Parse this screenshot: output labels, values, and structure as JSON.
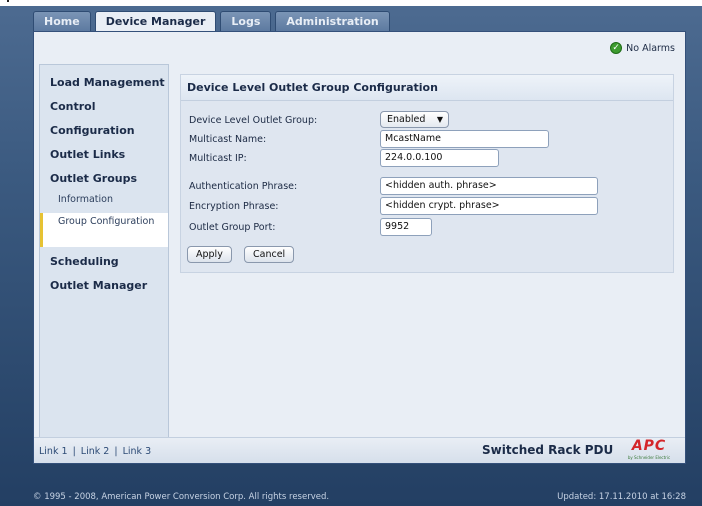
{
  "tabs": [
    {
      "label": "Home"
    },
    {
      "label": "Device Manager",
      "active": true
    },
    {
      "label": "Logs"
    },
    {
      "label": "Administration"
    }
  ],
  "alarm": {
    "text": "No Alarms",
    "icon": "check-circle-icon"
  },
  "nav": {
    "items": [
      {
        "label": "Load Management"
      },
      {
        "label": "Control"
      },
      {
        "label": "Configuration"
      },
      {
        "label": "Outlet Links"
      },
      {
        "label": "Outlet Groups"
      },
      {
        "label": "Scheduling"
      },
      {
        "label": "Outlet Manager"
      }
    ],
    "sub": [
      {
        "label": "Information"
      },
      {
        "label": "Group Configuration",
        "active": true
      }
    ]
  },
  "content": {
    "title": "Device Level Outlet Group Configuration",
    "fields": {
      "group_label": "Device Level Outlet Group:",
      "group_value": "Enabled",
      "mcast_name_label": "Multicast Name:",
      "mcast_name_value": "McastName",
      "mcast_ip_label": "Multicast IP:",
      "mcast_ip_value": "224.0.0.100",
      "auth_label": "Authentication Phrase:",
      "auth_value": "<hidden auth. phrase>",
      "enc_label": "Encryption Phrase:",
      "enc_value": "<hidden crypt. phrase>",
      "port_label": "Outlet Group Port:",
      "port_value": "9952"
    },
    "buttons": {
      "apply": "Apply",
      "cancel": "Cancel"
    }
  },
  "footer": {
    "links": [
      "Link 1",
      "Link 2",
      "Link 3"
    ],
    "separator": "|",
    "product": "Switched Rack PDU",
    "logo": "APC",
    "logo_sub": "by Schneider Electric"
  },
  "status": {
    "copyright": "© 1995 - 2008, American Power Conversion Corp. All rights reserved.",
    "updated": "Updated: 17.11.2010 at 16:28"
  },
  "colors": {
    "accent": "#1b2b48",
    "alarm_ok": "#3d9c2f",
    "logo_red": "#d4262a"
  }
}
